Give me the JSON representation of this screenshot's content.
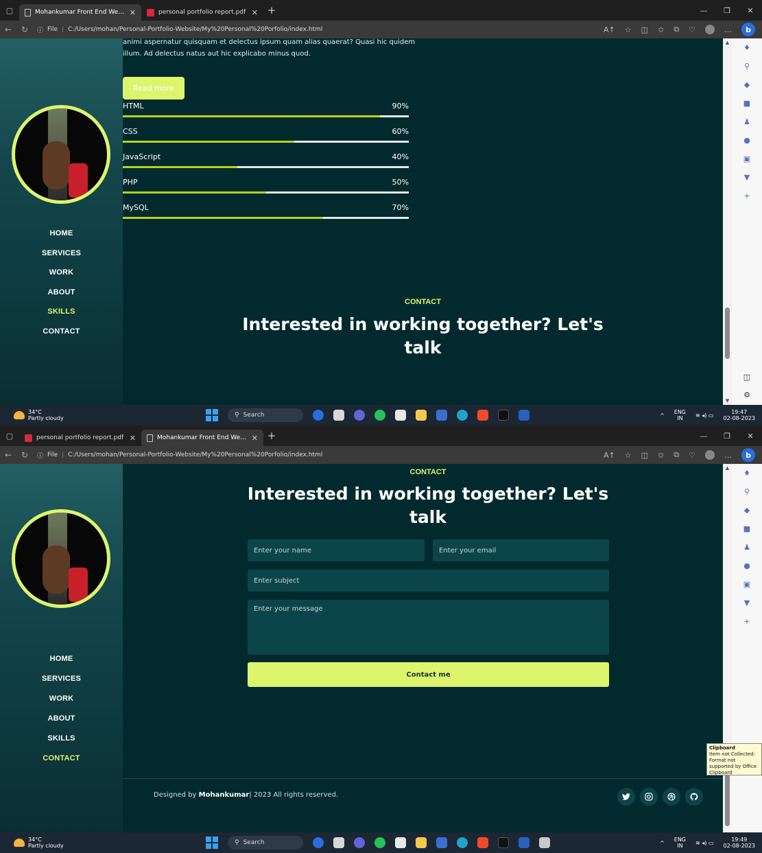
{
  "browser": {
    "url": "C:/Users/mohan/Personal-Portfolio-Website/My%20Personal%20Porfolio/index.html",
    "file_label": "File",
    "tab_portfolio": "Mohankumar Front End Web De",
    "tab_report": "personal portfolio report.pdf",
    "bing": "b"
  },
  "sidebar": {
    "menu": [
      "HOME",
      "SERVICES",
      "WORK",
      "ABOUT",
      "SKILLS",
      "CONTACT"
    ]
  },
  "about": {
    "text": "animi aspernatur quisquam et delectus ipsum quam alias quaerat? Quasi hic quidem illum. Ad delectus natus aut hic explicabo minus quod.",
    "read_more": "Read more"
  },
  "skills": [
    {
      "name": "HTML",
      "label": "90%",
      "value": 0.9
    },
    {
      "name": "CSS",
      "label": "60%",
      "value": 0.6
    },
    {
      "name": "JavaScript",
      "label": "40%",
      "value": 0.4
    },
    {
      "name": "PHP",
      "label": "50%",
      "value": 0.5
    },
    {
      "name": "MySQL",
      "label": "70%",
      "value": 0.7
    }
  ],
  "contact": {
    "label": "CONTACT",
    "title_line1": "Interested in working together? Let's",
    "title_line2": "talk",
    "name_placeholder": "Enter your name",
    "email_placeholder": "Enter your email",
    "subject_placeholder": "Enter subject",
    "message_placeholder": "Enter your message",
    "button": "Contact me"
  },
  "footer": {
    "prefix": "Designed by ",
    "author": "Mohankumar",
    "suffix": "| 2023 All rights reserved."
  },
  "clipboard": {
    "title": "Clipboard",
    "message": "Item not Collected: Format not supported by Office Clipboard"
  },
  "taskbar": {
    "temp": "34°C",
    "weather": "Partly cloudy",
    "search": "Search",
    "lang1": "ENG",
    "lang2": "IN",
    "time1": "19:47",
    "time2": "19:49",
    "date": "02-08-2023"
  },
  "colors": {
    "accent": "#ddf56d",
    "page_bg": "#022a2e",
    "bar_fill": "#b9d21c"
  }
}
